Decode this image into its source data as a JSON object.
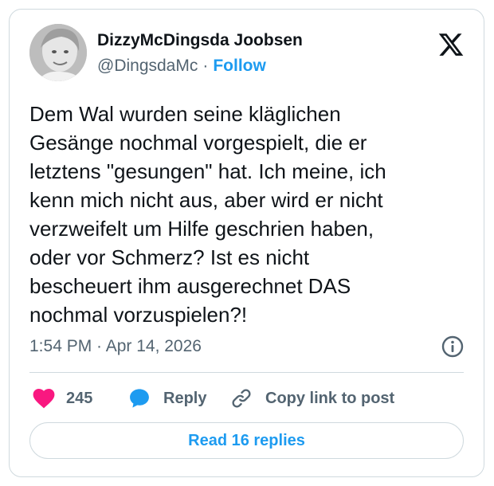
{
  "author": {
    "name": "DizzyMcDingsda Joobsen",
    "handle": "@DingsdaMc",
    "separator": "·",
    "follow_label": "Follow",
    "avatar_icon": "user-avatar-photo"
  },
  "brand": {
    "logo_icon": "x-logo-icon"
  },
  "post": {
    "text": "Dem Wal wurden seine kläglichen\nGesänge nochmal vorgespielt, die er\nletztens \"gesungen\" hat. Ich meine, ich\nkenn mich nicht aus, aber wird er nicht\nverzweifelt um Hilfe geschrien haben,\noder vor Schmerz? Ist es nicht\nbescheuert ihm ausgerechnet DAS\nnochmal vorzuspielen?!",
    "timestamp": "1:54 PM · Apr 14, 2026",
    "info_icon": "info-icon"
  },
  "actions": {
    "like_icon": "heart-icon",
    "like_count": "245",
    "reply_icon": "speech-bubble-icon",
    "reply_label": "Reply",
    "copy_icon": "link-icon",
    "copy_label": "Copy link to post"
  },
  "footer": {
    "read_replies_label": "Read 16 replies"
  },
  "colors": {
    "accent": "#1d9bf0",
    "like": "#f91880",
    "text": "#0f1419",
    "secondary": "#536471",
    "border": "#cfd9de"
  }
}
